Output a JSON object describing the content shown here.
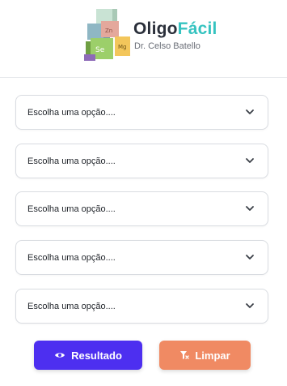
{
  "header": {
    "brand_part1": "Oligo",
    "brand_part2": "Fácil",
    "subtitle": "Dr. Celso Batello",
    "cube_labels": [
      "Zn",
      "Se",
      "Mg"
    ],
    "colors": {
      "brand_dark": "#2a2f3a",
      "brand_accent": "#35c3c0"
    }
  },
  "selects": [
    {
      "value": "Escolha uma opção...."
    },
    {
      "value": "Escolha uma opção...."
    },
    {
      "value": "Escolha uma opção...."
    },
    {
      "value": "Escolha uma opção...."
    },
    {
      "value": "Escolha uma opção...."
    }
  ],
  "actions": {
    "result_label": "Resultado",
    "result_icon": "eye-icon",
    "clear_label": "Limpar",
    "clear_icon": "filter-clear-icon",
    "colors": {
      "result": "#4d2ff0",
      "clear": "#f08a63"
    }
  }
}
